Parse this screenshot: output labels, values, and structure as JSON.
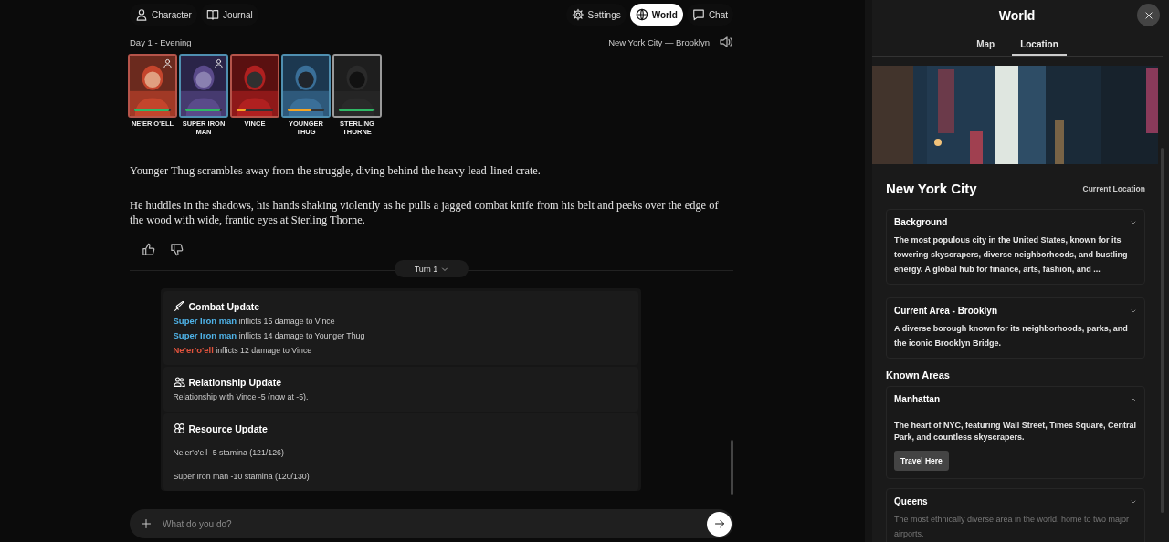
{
  "nav": {
    "left": [
      {
        "kind": "person",
        "label": "Character",
        "selected": false
      },
      {
        "kind": "book",
        "label": "Journal",
        "selected": false
      }
    ],
    "right": [
      {
        "kind": "gear",
        "label": "Settings",
        "selected": false
      },
      {
        "kind": "globe",
        "label": "World",
        "selected": true
      },
      {
        "kind": "chat",
        "label": "Chat",
        "selected": false
      }
    ]
  },
  "time": "Day 1 - Evening",
  "location": "New York City — Brooklyn",
  "characters": [
    {
      "name": "NE'ER'O'ELL",
      "color": "#b5544a",
      "player": true,
      "level": 0.95
    },
    {
      "name": "SUPER IRON MAN",
      "color": "#4f8fb0",
      "player": true,
      "level": 0.95
    },
    {
      "name": "VINCE",
      "color": "#b5544a",
      "player": false,
      "level": 0.25
    },
    {
      "name": "YOUNGER THUG",
      "color": "#4f8fb0",
      "player": false,
      "level": 0.65
    },
    {
      "name": "STERLING THORNE",
      "color": "#9a9a9a",
      "player": false,
      "level": 0.95
    }
  ],
  "story": [
    "Younger Thug scrambles away from the struggle, diving behind the heavy lead-lined crate.",
    "He huddles in the shadows, his hands shaking violently as he pulls a jagged combat knife from his belt and peeks over the edge of the wood with wide, frantic eyes at Sterling Thorne."
  ],
  "turn": "Turn 1",
  "updates": [
    {
      "kind": "combat",
      "title": "Combat Update",
      "lines": [
        {
          "actor": "Super Iron man",
          "color": "#4fb3e8",
          "text": "inflicts 15 damage to Vince"
        },
        {
          "actor": "Super Iron man",
          "color": "#4fb3e8",
          "text": "inflicts 14 damage to Younger Thug"
        },
        {
          "actor": "Ne'er'o'ell",
          "color": "#e0533d",
          "text": "inflicts 12 damage to Vince"
        }
      ]
    },
    {
      "kind": "relationship",
      "title": "Relationship Update",
      "lines": [
        {
          "text": "Relationship with Vince -5 (now at -5)."
        }
      ]
    },
    {
      "kind": "resource",
      "title": "Resource Update",
      "lines": [
        {
          "text": "Ne'er'o'ell -5 stamina (121/126)"
        },
        {
          "text": "Super Iron man -10 stamina (120/130)"
        }
      ]
    }
  ],
  "input": {
    "placeholder": "What do you do?"
  },
  "panel": {
    "title": "World",
    "tabs": [
      {
        "label": "Map",
        "selected": false
      },
      {
        "label": "Location",
        "selected": true
      }
    ],
    "location_name": "New York City",
    "location_badge": "Current Location",
    "sections": [
      {
        "title": "Background",
        "expanded": false,
        "text": "The most populous city in the United States, known for its towering skyscrapers, diverse neighborhoods, and bustling energy. A global hub for finance, arts, fashion, and ..."
      },
      {
        "title": "Current Area - Brooklyn",
        "expanded": false,
        "text": "A diverse borough known for its neighborhoods, parks, and the iconic Brooklyn Bridge."
      }
    ],
    "known_title": "Known Areas",
    "areas": [
      {
        "title": "Manhattan",
        "expanded": true,
        "text": "The heart of NYC, featuring Wall Street, Times Square, Central Park, and countless skyscrapers.",
        "button": "Travel Here"
      },
      {
        "title": "Queens",
        "expanded": false,
        "text": "The most ethnically diverse area in the world, home to two major airports."
      }
    ]
  }
}
